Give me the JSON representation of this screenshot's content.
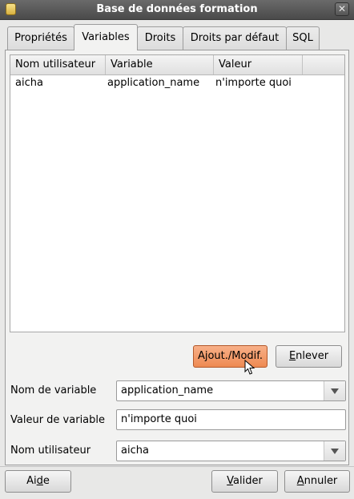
{
  "window": {
    "title": "Base de données formation",
    "close_glyph": "✕"
  },
  "tabs": [
    {
      "label": "Propriétés"
    },
    {
      "label": "Variables"
    },
    {
      "label": "Droits"
    },
    {
      "label": "Droits par défaut"
    },
    {
      "label": "SQL"
    }
  ],
  "table": {
    "columns": [
      "Nom utilisateur",
      "Variable",
      "Valeur"
    ],
    "rows": [
      [
        "aicha",
        "application_name",
        "n'importe quoi"
      ]
    ]
  },
  "actions": {
    "add_modify": "Ajout./Modif.",
    "remove_prefix": "",
    "remove_mnemonic": "E",
    "remove_rest": "nlever"
  },
  "form": {
    "variable_name_label": "Nom de variable",
    "variable_name_value": "application_name",
    "variable_value_label": "Valeur de variable",
    "variable_value_value": "n'importe quoi",
    "username_label": "Nom utilisateur",
    "username_value": "aicha"
  },
  "footer": {
    "help_prefix": "Ai",
    "help_mnemonic": "d",
    "help_rest": "e",
    "ok_prefix": "",
    "ok_mnemonic": "V",
    "ok_rest": "alider",
    "cancel_prefix": "",
    "cancel_mnemonic": "A",
    "cancel_rest": "nnuler"
  },
  "colors": {
    "primary_button": "#ee8a52",
    "titlebar": "#4a4a4a"
  }
}
